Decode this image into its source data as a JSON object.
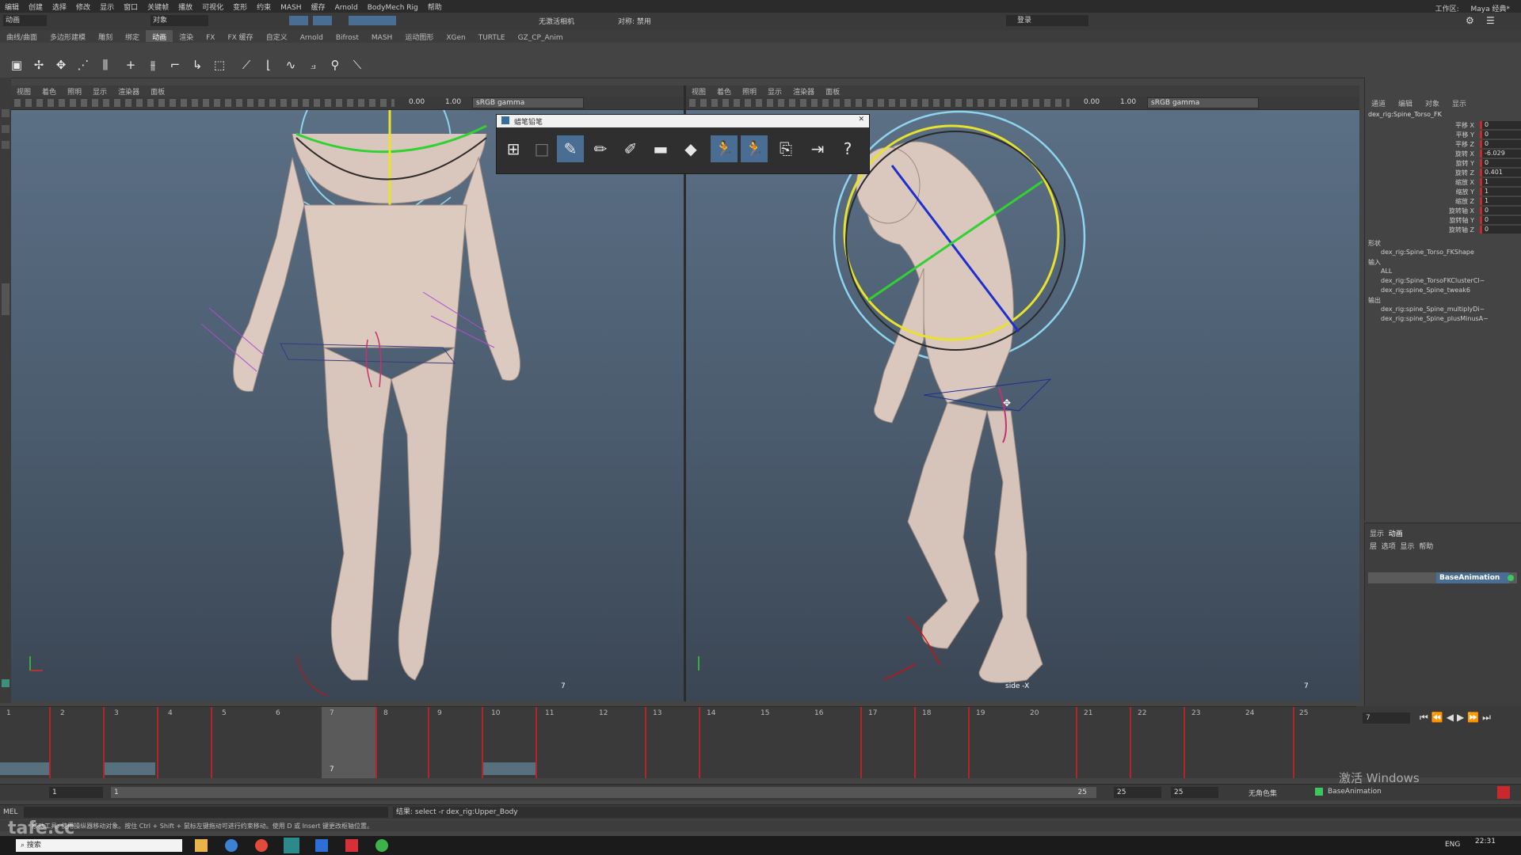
{
  "menubar": {
    "items": [
      "编辑",
      "创建",
      "选择",
      "修改",
      "显示",
      "窗口",
      "关键帧",
      "播放",
      "可视化",
      "变形",
      "约束",
      "MASH",
      "缓存",
      "Arnold",
      "BodyMech Rig",
      "帮助"
    ],
    "workspace_label": "工作区:",
    "workspace_value": "Maya 经典*"
  },
  "statusline": {
    "mode": "动画",
    "object_field": "对象",
    "snap_label": "无激活相机",
    "symmetry": "对称: 禁用",
    "login": "登录"
  },
  "shelf": {
    "tabs": [
      "曲线/曲面",
      "多边形建模",
      "雕刻",
      "绑定",
      "动画",
      "渲染",
      "FX",
      "FX 缓存",
      "自定义",
      "Arnold",
      "Bifrost",
      "MASH",
      "运动图形",
      "XGen",
      "TURTLE",
      "GZ_CP_Anim"
    ],
    "active_tab": "动画"
  },
  "viewport_left": {
    "menu": [
      "视图",
      "着色",
      "照明",
      "显示",
      "渲染器",
      "面板"
    ],
    "exposure": "0.00",
    "gamma": "1.00",
    "colorspace": "sRGB gamma",
    "cam_marker": "7"
  },
  "viewport_right": {
    "menu": [
      "视图",
      "着色",
      "照明",
      "显示",
      "渲染器",
      "面板"
    ],
    "exposure": "0.00",
    "gamma": "1.00",
    "colorspace": "sRGB gamma",
    "camera_name": "side -X",
    "cam_marker": "7"
  },
  "grease_pencil": {
    "title": "蜡笔铅笔",
    "tools": [
      "add-frame-icon",
      "pencil-icon",
      "marker-icon",
      "soft-pencil-icon",
      "eraser-icon",
      "hard-eraser-icon",
      "ghost-prev-icon",
      "ghost-next-icon",
      "import-icon",
      "export-icon",
      "help-icon"
    ]
  },
  "channel_box": {
    "tabs": [
      "通道",
      "编辑",
      "对象",
      "显示"
    ],
    "node": "dex_rig:Spine_Torso_FK",
    "attributes": [
      {
        "label": "平移 X",
        "value": "0"
      },
      {
        "label": "平移 Y",
        "value": "0"
      },
      {
        "label": "平移 Z",
        "value": "0"
      },
      {
        "label": "旋转 X",
        "value": "-6.029"
      },
      {
        "label": "旋转 Y",
        "value": "0"
      },
      {
        "label": "旋转 Z",
        "value": "0.401"
      },
      {
        "label": "缩放 X",
        "value": "1"
      },
      {
        "label": "缩放 Y",
        "value": "1"
      },
      {
        "label": "缩放 Z",
        "value": "1"
      },
      {
        "label": "旋转轴 X",
        "value": "0"
      },
      {
        "label": "旋转轴 Y",
        "value": "0"
      },
      {
        "label": "旋转轴 Z",
        "value": "0"
      }
    ],
    "shapes_header": "形状",
    "shape_node": "dex_rig:Spine_Torso_FKShape",
    "inputs_header": "输入",
    "inputs": [
      "ALL",
      "dex_rig:Spine_TorsoFKClusterCl~",
      "dex_rig:spine_Spine_tweak6"
    ],
    "outputs_header": "输出",
    "outputs": [
      "dex_rig:spine_Spine_multiplyDi~",
      "dex_rig:spine_Spine_plusMinusA~"
    ]
  },
  "layer_editor": {
    "tabs": [
      "显示",
      "动画"
    ],
    "menu": [
      "层",
      "选项",
      "显示",
      "帮助"
    ],
    "layer_name": "BaseAnimation"
  },
  "timeline": {
    "frames": [
      "1",
      "2",
      "3",
      "4",
      "5",
      "6",
      "7",
      "8",
      "9",
      "10",
      "11",
      "12",
      "13",
      "14",
      "15",
      "16",
      "17",
      "18",
      "19",
      "20",
      "21",
      "22",
      "23",
      "24",
      "25"
    ],
    "current_frame": "7"
  },
  "playback": {
    "current": "7"
  },
  "range": {
    "start": "1",
    "inner_start": "1",
    "inner_end": "25",
    "end": "25",
    "end2": "25",
    "character_set": "无角色集",
    "anim_layer": "BaseAnimation"
  },
  "command": {
    "lang": "MEL",
    "result": "结果: select -r dex_rig:Upper_Body"
  },
  "helpline": {
    "text": "移动工具: 使用操纵器移动对象。按住 Ctrl + Shift + 鼠标左键拖动可进行约束移动。使用 D 或 Insert 键更改枢轴位置。"
  },
  "taskbar": {
    "search_placeholder": "搜索",
    "time": "22:31",
    "lang": "ENG"
  },
  "overlay": {
    "windows_activate": "激活 Windows",
    "watermark": "tafe.cc"
  },
  "colors": {
    "accent": "#4a6e93",
    "key": "#b3242a",
    "viewport_top": "#5b6f85",
    "viewport_bottom": "#3b4654"
  }
}
